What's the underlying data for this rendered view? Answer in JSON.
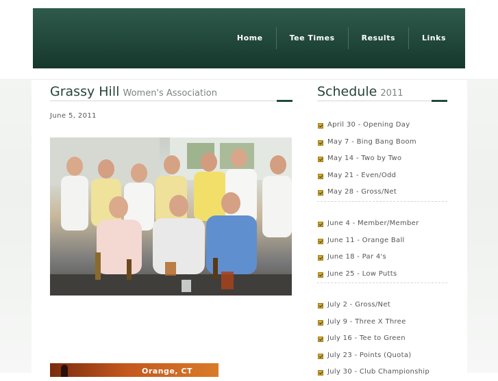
{
  "nav": {
    "items": [
      {
        "label": "Home"
      },
      {
        "label": "Tee Times"
      },
      {
        "label": "Results"
      },
      {
        "label": "Links"
      }
    ]
  },
  "main": {
    "title": "Grassy Hill",
    "subtitle": "Women's Association",
    "date": "June 5, 2011",
    "photo_icon": "group-photo",
    "banner_text": "Orange, CT"
  },
  "sidebar": {
    "title": "Schedule",
    "year": "2011",
    "icon": "checkbox-icon",
    "groups": [
      {
        "items": [
          "April 30 - Opening Day",
          "May 7 - Bing Bang Boom",
          "May 14 - Two by Two",
          "May 21 - Even/Odd",
          "May 28 - Gross/Net"
        ]
      },
      {
        "items": [
          "June 4 - Member/Member",
          "June 11 - Orange Ball",
          "June 18 - Par 4's",
          "June 25 - Low Putts"
        ]
      },
      {
        "items": [
          "July 2 - Gross/Net",
          "July 9 - Three X Three",
          "July 16 - Tee to Green",
          "July 23 - Points (Quota)",
          "July 30 - Club Championship"
        ]
      }
    ]
  },
  "colors": {
    "header_top": "#2f5a4c",
    "header_bottom": "#15382b",
    "title": "#26433a",
    "accent": "#1e4a3b",
    "check": "#d7a92e"
  }
}
